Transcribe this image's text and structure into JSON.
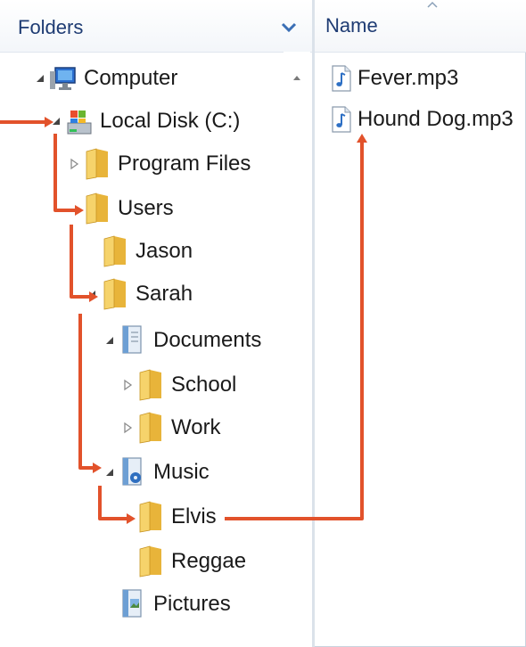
{
  "folders_pane": {
    "title": "Folders"
  },
  "tree": [
    {
      "key": "computer",
      "label": "Computer",
      "icon": "computer-icon",
      "expander": "expanded"
    },
    {
      "key": "local-disk",
      "label": "Local Disk (C:)",
      "icon": "drive-icon",
      "expander": "expanded"
    },
    {
      "key": "program-files",
      "label": "Program Files",
      "icon": "folder-icon",
      "expander": "collapsed"
    },
    {
      "key": "users",
      "label": "Users",
      "icon": "folder-icon",
      "expander": "none"
    },
    {
      "key": "jason",
      "label": "Jason",
      "icon": "folder-icon",
      "expander": "none"
    },
    {
      "key": "sarah",
      "label": "Sarah",
      "icon": "folder-icon",
      "expander": "expanded"
    },
    {
      "key": "documents",
      "label": "Documents",
      "icon": "documents-library-icon",
      "expander": "expanded"
    },
    {
      "key": "school",
      "label": "School",
      "icon": "folder-icon",
      "expander": "collapsed"
    },
    {
      "key": "work",
      "label": "Work",
      "icon": "folder-icon",
      "expander": "collapsed"
    },
    {
      "key": "music",
      "label": "Music",
      "icon": "music-library-icon",
      "expander": "expanded"
    },
    {
      "key": "elvis",
      "label": "Elvis",
      "icon": "folder-icon",
      "expander": "none"
    },
    {
      "key": "reggae",
      "label": "Reggae",
      "icon": "folder-icon",
      "expander": "none"
    },
    {
      "key": "pictures",
      "label": "Pictures",
      "icon": "pictures-library-icon",
      "expander": "none"
    }
  ],
  "files_pane": {
    "column_header": "Name",
    "files": [
      {
        "name": "Fever.mp3",
        "icon": "audio-file-icon"
      },
      {
        "name": "Hound Dog.mp3",
        "icon": "audio-file-icon"
      }
    ]
  },
  "colors": {
    "path_arrow": "#e2522b",
    "header_text": "#1e3b73",
    "folder_yellow": "#f3c64a"
  }
}
